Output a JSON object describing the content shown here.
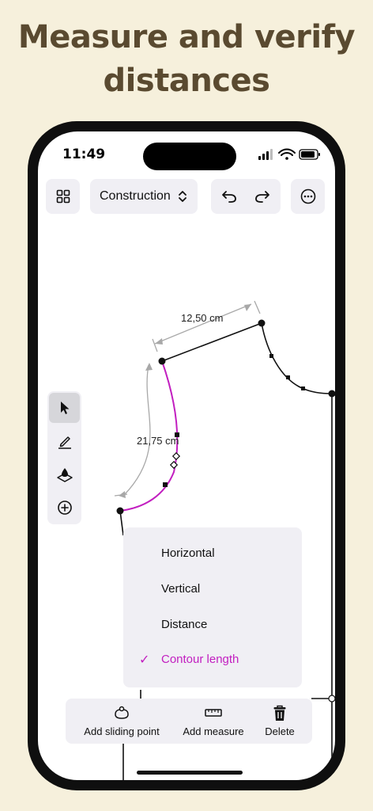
{
  "headline": {
    "line1": "Measure and verify",
    "line2": "distances"
  },
  "status_bar": {
    "time": "11:49"
  },
  "toolbar": {
    "grid_icon": "grid-icon",
    "mode_label": "Construction",
    "undo_icon": "undo-icon",
    "redo_icon": "redo-icon",
    "more_icon": "more-icon"
  },
  "canvas": {
    "measure_top": "12,50 cm",
    "measure_curve": "21,75 cm",
    "accent_color": "#c21fc0"
  },
  "tools": [
    {
      "name": "select-tool",
      "icon": "pointer-icon",
      "active": true
    },
    {
      "name": "pen-tool",
      "icon": "pen-icon",
      "active": false
    },
    {
      "name": "point-tool",
      "icon": "point-icon",
      "active": false
    },
    {
      "name": "add-tool",
      "icon": "plus-icon",
      "active": false
    }
  ],
  "measure_menu": {
    "items": [
      {
        "label": "Horizontal",
        "selected": false
      },
      {
        "label": "Vertical",
        "selected": false
      },
      {
        "label": "Distance",
        "selected": false
      },
      {
        "label": "Contour length",
        "selected": true
      }
    ],
    "check_mark": "✓"
  },
  "bottom_bar": {
    "add_sliding_point": "Add sliding point",
    "add_measure": "Add measure",
    "delete": "Delete"
  }
}
